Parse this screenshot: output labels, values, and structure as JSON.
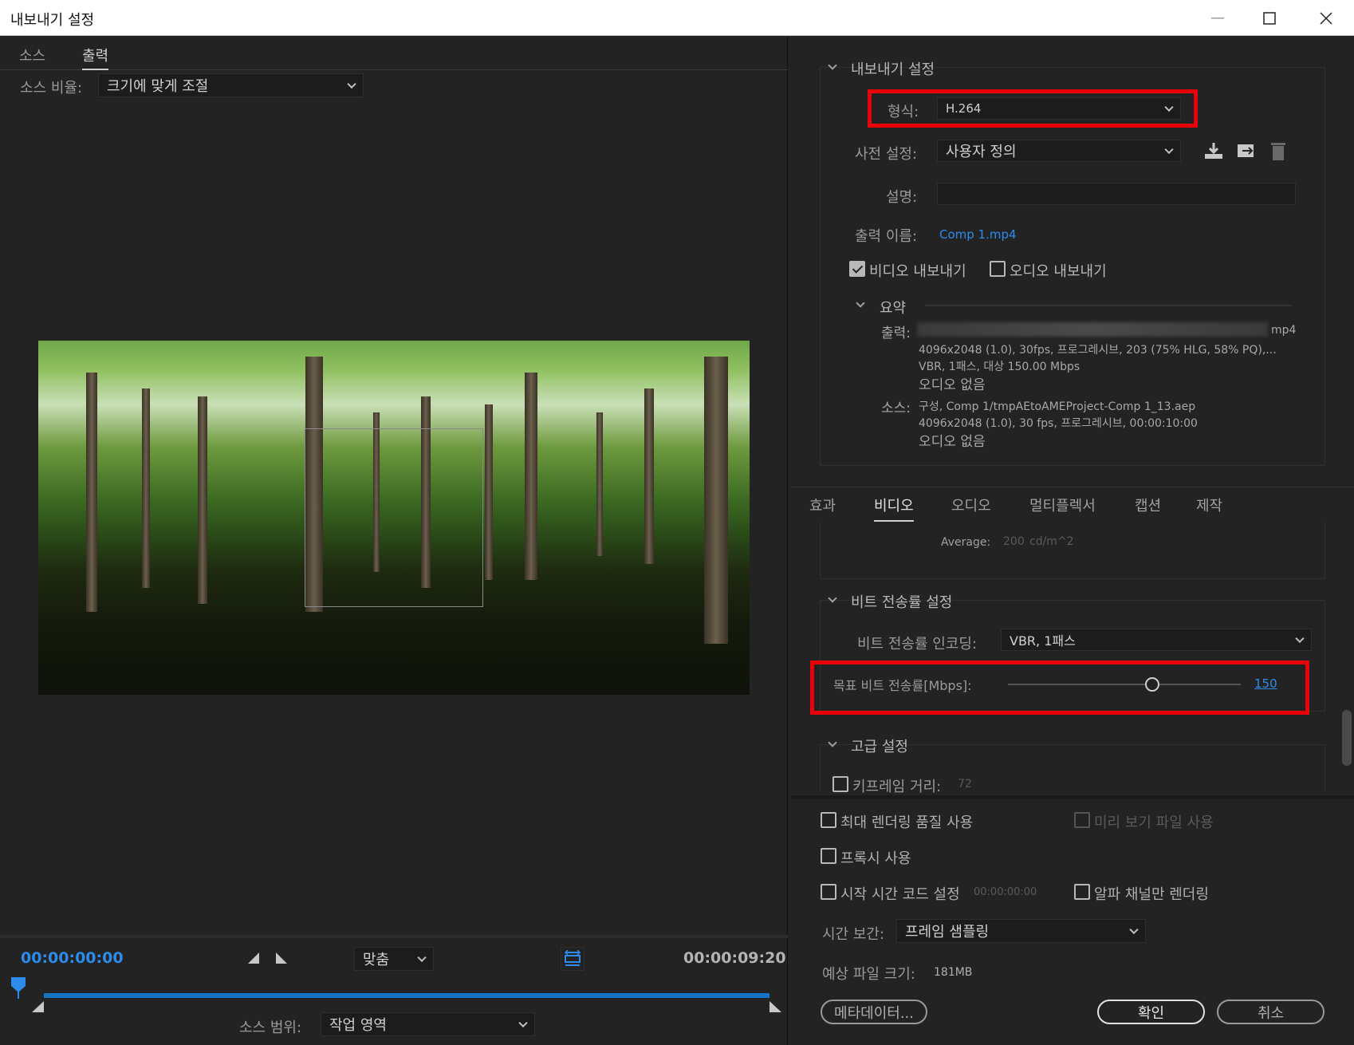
{
  "window": {
    "title": "내보내기 설정",
    "minimize_icon": "minimize-icon",
    "maximize_icon": "maximize-icon",
    "close_icon": "close-icon"
  },
  "left": {
    "tabs": [
      {
        "label": "소스"
      },
      {
        "label": "출력",
        "active": true
      }
    ],
    "source_scaling_label": "소스 비율:",
    "source_scaling_value": "크기에 맞게 조절",
    "timecode_start": "00:00:00:00",
    "timecode_end": "00:00:09:20",
    "zoom_value": "맞춤",
    "source_range_label": "소스 범위:",
    "source_range_value": "작업 영역"
  },
  "right": {
    "export_settings": {
      "header": "내보내기 설정",
      "format_label": "형식:",
      "format_value": "H.264",
      "preset_label": "사전 설정:",
      "preset_value": "사용자 정의",
      "comments_label": "설명:",
      "comments_value": "",
      "output_name_label": "출력 이름:",
      "output_name_value": "Comp 1.mp4",
      "export_video_label": "비디오 내보내기",
      "export_video_checked": true,
      "export_audio_label": "오디오 내보내기",
      "export_audio_checked": false
    },
    "summary": {
      "header": "요약",
      "output_label": "출력:",
      "output_path_tail": "mp4",
      "output_line1": "4096x2048 (1.0), 30fps, 프로그레시브, 203 (75% HLG, 58% PQ),...",
      "output_line2": "VBR, 1패스, 대상 150.00 Mbps",
      "output_line3": "오디오 없음",
      "source_label": "소스:",
      "source_line1": "구성, Comp 1/tmpAEtoAMEProject-Comp 1_13.aep",
      "source_line2": "4096x2048 (1.0), 30 fps, 프로그레시브, 00:00:10:00",
      "source_line3": "오디오 없음"
    },
    "tabs": [
      {
        "label": "효과"
      },
      {
        "label": "비디오",
        "active": true
      },
      {
        "label": "오디오"
      },
      {
        "label": "멀티플렉서"
      },
      {
        "label": "캡션"
      },
      {
        "label": "제작"
      }
    ],
    "average_label": "Average:",
    "average_value": "200",
    "average_unit": "cd/m^2",
    "bitrate": {
      "header": "비트 전송률 설정",
      "encoding_label": "비트 전송률 인코딩:",
      "encoding_value": "VBR, 1패스",
      "target_label": "목표 비트 전송률[Mbps]:",
      "target_value": "150",
      "target_fraction": 0.62
    },
    "advanced": {
      "header": "고급 설정",
      "keyframe_label": "키프레임 거리:",
      "keyframe_value": "72"
    },
    "bottom": {
      "max_render_quality": "최대 렌더링 품질 사용",
      "use_previews": "미리 보기 파일 사용",
      "use_proxies": "프록시 사용",
      "set_start_timecode": "시작 시간 코드 설정",
      "start_timecode_value": "00:00:00:00",
      "render_alpha_only": "알파 채널만 렌더링",
      "time_interpolation_label": "시간 보간:",
      "time_interpolation_value": "프레임 샘플링",
      "estimated_size_label": "예상 파일 크기:",
      "estimated_size_value": "181MB",
      "metadata_button": "메타데이터...",
      "ok_button": "확인",
      "cancel_button": "취소"
    }
  },
  "colors": {
    "accent_blue": "#2d8ceb",
    "highlight_red": "#e8000b",
    "panel_bg": "#232323"
  }
}
